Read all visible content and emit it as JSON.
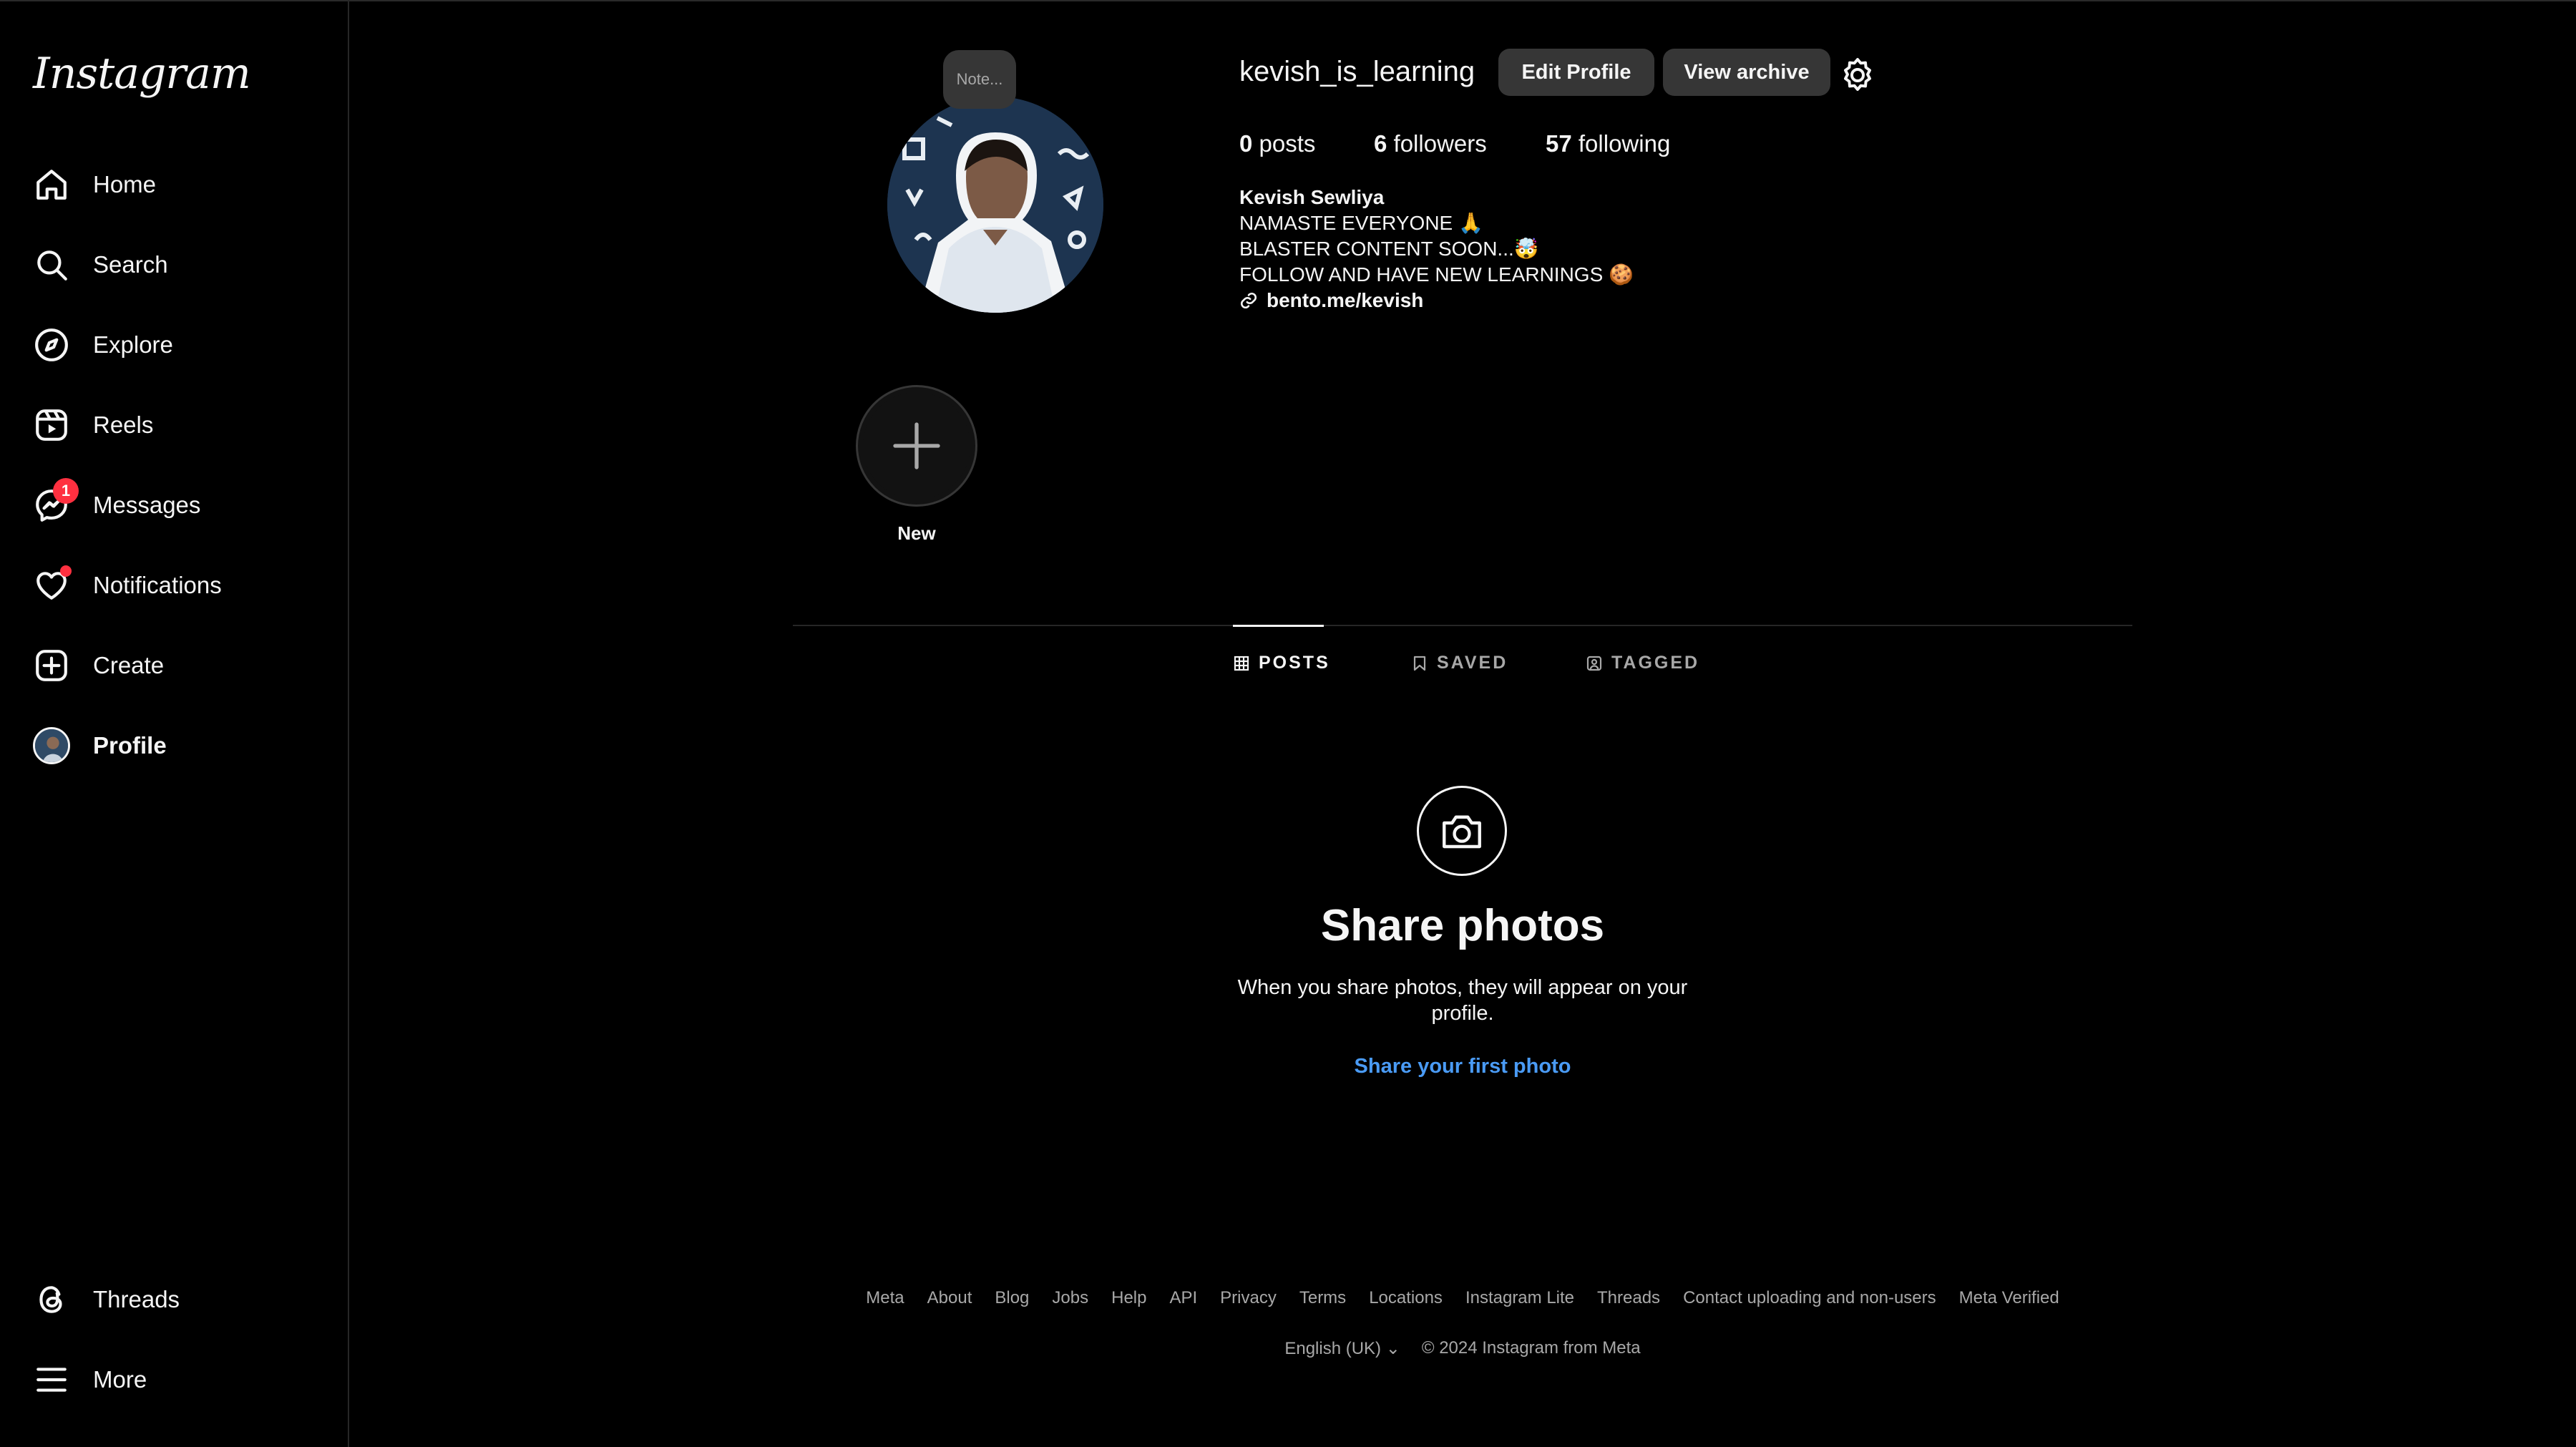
{
  "app": {
    "logo": "Instagram"
  },
  "sidebar": {
    "items": [
      {
        "label": "Home",
        "icon": "home-icon"
      },
      {
        "label": "Search",
        "icon": "search-icon"
      },
      {
        "label": "Explore",
        "icon": "compass-icon"
      },
      {
        "label": "Reels",
        "icon": "reels-icon"
      },
      {
        "label": "Messages",
        "icon": "messenger-icon",
        "badge": "1"
      },
      {
        "label": "Notifications",
        "icon": "heart-icon"
      },
      {
        "label": "Create",
        "icon": "plus-square-icon"
      },
      {
        "label": "Profile",
        "icon": "avatar"
      }
    ],
    "bottom": [
      {
        "label": "Threads",
        "icon": "threads-icon"
      },
      {
        "label": "More",
        "icon": "menu-icon"
      }
    ]
  },
  "profile": {
    "note": "Note...",
    "username": "kevish_is_learning",
    "edit_button": "Edit Profile",
    "archive_button": "View archive",
    "stats": {
      "posts_count": "0",
      "posts_label": "posts",
      "followers_count": "6",
      "followers_label": "followers",
      "following_count": "57",
      "following_label": "following"
    },
    "bio": {
      "name": "Kevish Sewliya",
      "line1": "NAMASTE EVERYONE 🙏",
      "line2": "BLASTER CONTENT SOON...🤯",
      "line3": "FOLLOW AND HAVE NEW LEARNINGS 🍪",
      "link": "bento.me/kevish"
    },
    "highlight_new": "New"
  },
  "tabs": [
    {
      "label": "POSTS",
      "icon": "grid-icon",
      "active": true
    },
    {
      "label": "SAVED",
      "icon": "bookmark-icon",
      "active": false
    },
    {
      "label": "TAGGED",
      "icon": "tag-icon",
      "active": false
    }
  ],
  "empty_state": {
    "title": "Share photos",
    "description": "When you share photos, they will appear on your profile.",
    "cta": "Share your first photo"
  },
  "footer": {
    "links": [
      "Meta",
      "About",
      "Blog",
      "Jobs",
      "Help",
      "API",
      "Privacy",
      "Terms",
      "Locations",
      "Instagram Lite",
      "Threads",
      "Contact uploading and non-users",
      "Meta Verified"
    ],
    "language": "English (UK)",
    "copyright": "© 2024 Instagram from Meta"
  },
  "colors": {
    "accent_link": "#4a9bf5",
    "badge": "#ff3040",
    "background": "#000000",
    "button": "#363636"
  }
}
